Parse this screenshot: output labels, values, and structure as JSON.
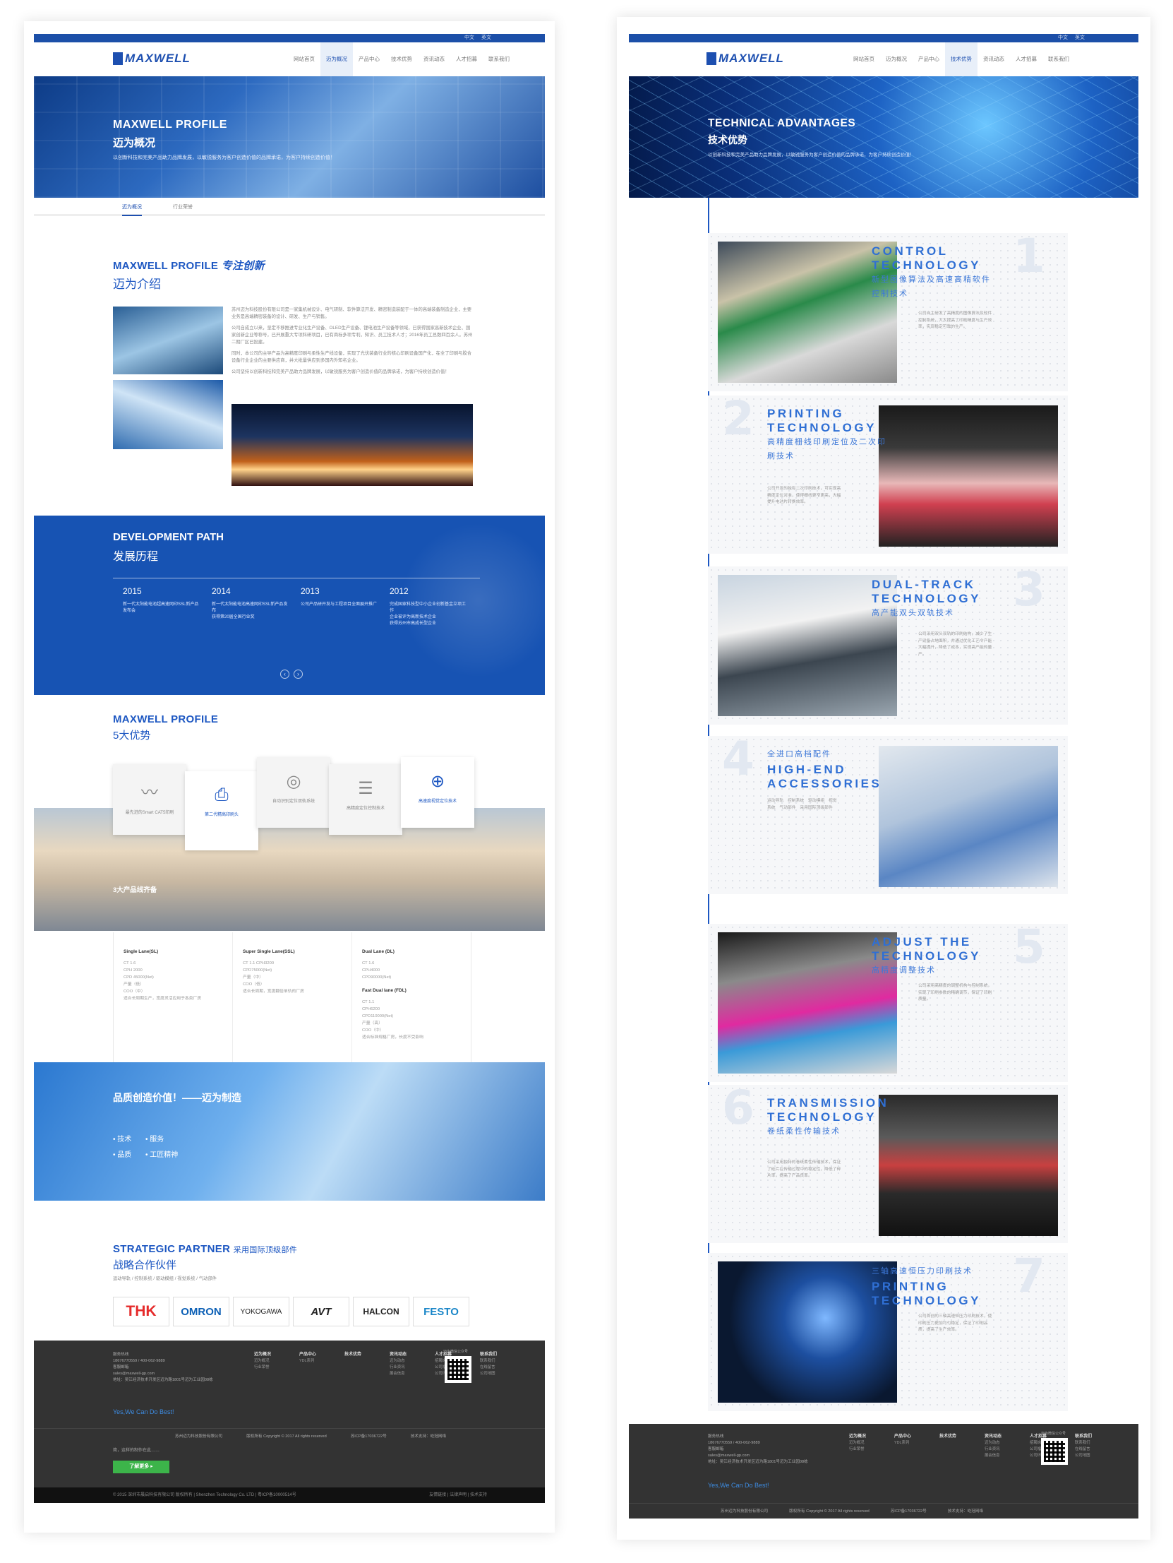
{
  "lang": {
    "zh": "中文",
    "en": "英文"
  },
  "brand": "MAXWELL",
  "nav": [
    "网站首页",
    "迈为概况",
    "产品中心",
    "技术优势",
    "资讯动态",
    "人才招募",
    "联系我们"
  ],
  "left": {
    "hero": {
      "title": "MAXWELL PROFILE",
      "subtitle": "迈为概况",
      "desc": "以创新科技和完美产品助力品牌发展，以敏锐服务为客户创造价值的品牌承诺，为客户持续创造价值！"
    },
    "tabs": [
      "迈为概况",
      "行业荣誉"
    ],
    "intro": {
      "title": "MAXWELL PROFILE",
      "badge": "专注创新",
      "subtitle": "迈为介绍",
      "paras": [
        "苏州迈为科技股份有限公司是一家集机械设计、电气研制、软件算法开发、精密制造装配于一体的高端装备制造企业，主要业务是高端精密装备的设计、研发、生产与销售。",
        "公司自成立以来，坚定不移推进专业化生产设备、OLED生产设备、锂电池生产设备等领域，已获得国家高新技术企业、国家创新企业等称号，已开展重大专项科研项目，已有商标多项专利，知识、员工技术人才；2016年员工总数四百余人。苏州二期厂区已投建。",
        "同时，本公司的主导产品为高精度印刷与柔性生产线设备，实现了光伏装备行业的核心印刷设备国产化，在全了印刷与胶合设备行业企业的主要供应商，并大批量供应到多国内外知名企业。",
        "公司坚持以创新科技和完美产品助力品牌发展，以敏锐服务为客户创造价值的品牌承诺，为客户持续创造价值！"
      ]
    },
    "dev": {
      "title": "DEVELOPMENT PATH",
      "subtitle": "发展历程",
      "years": [
        {
          "year": "2015",
          "items": [
            "新一代太阳能电池超高速网印SSL新产品发布会"
          ]
        },
        {
          "year": "2014",
          "items": [
            "新一代太阳能电池高速网印SSL新产品发布",
            "获得第20届全国行业奖"
          ]
        },
        {
          "year": "2013",
          "items": [
            "公司产品研开发与工程项目全面展开推广"
          ]
        },
        {
          "year": "2012",
          "items": [
            "完成国家科技型中小企业创新基金立项工作",
            "企业被评为高新技术企业",
            "获得苏州市高成长型企业"
          ]
        }
      ],
      "prev": "‹",
      "next": "›"
    },
    "adv": {
      "title": "MAXWELL PROFILE",
      "subtitle": "5大优势",
      "cards": [
        "最先进的Smart CAT5印刷",
        "第二代精高印刷头",
        "自动识别定位双轨系统",
        "高精度定位控制技术",
        "高速度视觉定位技术"
      ]
    },
    "lines": {
      "title": "3大产品线齐备",
      "cols": [
        {
          "name": "Single Lane(SL)",
          "specs": [
            "CT 1.6",
            "CPH 2000",
            "CPD 45000(Net)",
            "产量（低）",
            "COO（中）",
            "适合长周期生产，宽度灵活应用于各类厂房"
          ]
        },
        {
          "name": "Super Single Lane(SSL)",
          "specs": [
            "CT 1.1 CPH3200",
            "CPD75000(Net)",
            "产量（中）",
            "COO（低）",
            "适合长周期，宽度翻倍单轨的厂房"
          ]
        },
        {
          "name": "Dual Lane (DL)",
          "specs": [
            "CT 1.6",
            "CPH4000",
            "CPD90000(Net)"
          ],
          "name2": "Fast Dual lane (FDL)",
          "specs2": [
            "CT 1.1",
            "CPH6200",
            "CPD110000(Net)",
            "产量（高）",
            "COO（中）",
            "适合标准规格厂房，长度不受影响"
          ]
        }
      ]
    },
    "quality": {
      "title": "品质创造价值！——迈为制造",
      "items": [
        "技术",
        "服务",
        "品质",
        "工匠精神"
      ]
    },
    "partner": {
      "title": "STRATEGIC PARTNER",
      "tag": "采用国际顶级部件",
      "subtitle": "战略合作伙伴",
      "desc": "运动导轨 / 控制系统 / 驱动模组 / 视觉系统 / 气动部件",
      "logos": [
        "THK",
        "OMRON",
        "YOKOGAWA",
        "AVT",
        "HALCON",
        "FESTO"
      ]
    },
    "footer": {
      "contact": [
        "服务热线",
        "18676770559 / 400-062-9889",
        "客服邮箱",
        "sales@maxwell-gp.com",
        "地址：吴江经济技术开发区迈为路1801号迈为工业园08栋"
      ],
      "cols": [
        {
          "h": "迈为概况",
          "items": [
            "迈为概况",
            "行业荣誉"
          ]
        },
        {
          "h": "产品中心",
          "items": [
            "YDL系列"
          ]
        },
        {
          "h": "技术优势",
          "items": []
        },
        {
          "h": "资讯动态",
          "items": [
            "迈为动态",
            "行业资讯",
            "展会信息"
          ]
        },
        {
          "h": "人才招募",
          "items": [
            "招聘岗位",
            "公司福利",
            "公司环境"
          ]
        },
        {
          "h": "联系我们",
          "items": [
            "联系我们",
            "在线留言",
            "公司地图"
          ]
        }
      ],
      "qr_label": "迈为微信公众号",
      "slogan": "Yes,We Can Do Best!",
      "copy": [
        "苏州迈为科技股份有限公司",
        "版权所有 Copyright © 2017 All rights reserved",
        "苏ICP备17036722号",
        "技术支持：屹冠网络"
      ],
      "note": "简，这样的制作在此……",
      "more": "了解更多 ▸",
      "bottom": "© 2015 深圳市晨启科技有限公司 版权所有 | Shenzhen Technology Co. LTD | 粤ICP备10000514号",
      "bottom_right": "友情链接 | 法律声明 | 技术支持"
    }
  },
  "right": {
    "hero": {
      "title": "TECHNICAL ADVANTAGES",
      "subtitle": "技术优势",
      "desc": "以创新科技和完美产品助力品牌发展，以敏锐服务为客户创造价值的品牌承诺，为客户持续创造价值！"
    },
    "techs": [
      {
        "num": "1",
        "en": [
          "CONTROL",
          "TECHNOLOGY"
        ],
        "cn": [
          "新型图像算法及高速高精软件",
          "控制技术"
        ],
        "desc": "公司自主研发了高精度的图像算法及软件控制系统，大大提高了印刷精度与生产效率，实现稳定可靠的生产。"
      },
      {
        "num": "2",
        "en": [
          "PRINTING",
          "TECHNOLOGY"
        ],
        "cn": [
          "高精度栅线印刷定位及二次印",
          "刷技术"
        ],
        "desc": "公司开发的独有二次印刷技术，可实现高精度定位对准，使得栅线更窄更高，大幅提升电池片转换效率。"
      },
      {
        "num": "3",
        "en": [
          "DUAL-TRACK",
          "TECHNOLOGY"
        ],
        "cn": [
          "高产能双头双轨技术"
        ],
        "desc": "公司采用双头双轨的印刷结构，减少了生产设备占地面积，并通过优化工艺令产能大幅提升，降低了成本，实现高产能的量产。"
      },
      {
        "num": "4",
        "en": [
          "HIGH-END",
          "ACCESSORIES"
        ],
        "cn": [
          "全进口高档配件"
        ],
        "desc": "运动导轨　控制系统　驱动模组　视觉系统　气动部件　采用国际顶级部件"
      },
      {
        "num": "5",
        "en": [
          "ADJUST THE",
          "TECHNOLOGY"
        ],
        "cn": [
          "高精度调整技术"
        ],
        "desc": "公司采用高精度的调整机构与控制系统，实现了印刷参数的精确调节，保证了印刷质量。"
      },
      {
        "num": "6",
        "en": [
          "TRANSMISSION",
          "TECHNOLOGY"
        ],
        "cn": [
          "卷纸柔性传输技术"
        ],
        "desc": "公司采用独特的卷纸柔性传输技术，保证了硅片在传输过程中的稳定性，降低了碎片率，提高了产品良率。"
      },
      {
        "num": "7",
        "en": [
          "PRINTING",
          "TECHNOLOGY"
        ],
        "cn": [
          "三轴高速恒压力印刷技术"
        ],
        "desc": "公司首创的三轴高速恒压力印刷技术，使印刷压力更加均匀稳定，保证了印刷品质，提高了生产效率。"
      }
    ]
  }
}
